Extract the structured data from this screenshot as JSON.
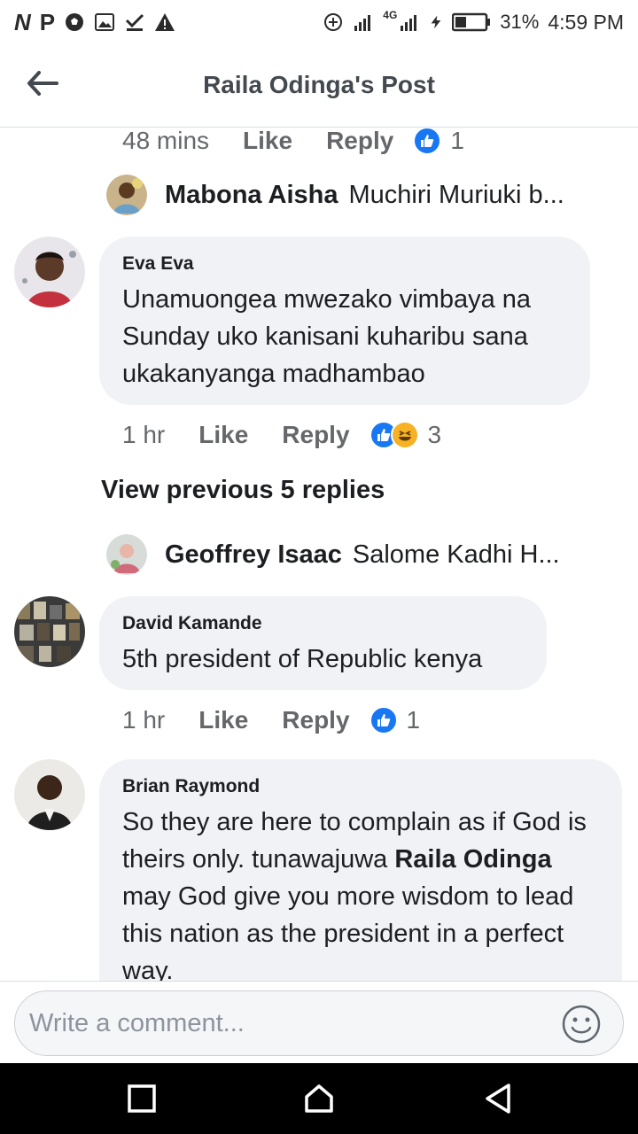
{
  "status_bar": {
    "left_icons": [
      "N",
      "P"
    ],
    "left_icon_names": [
      "soccer-icon",
      "image-icon",
      "check-icon",
      "warning-icon"
    ],
    "battery": "31%",
    "time": "4:59 PM",
    "network": "4G"
  },
  "header": {
    "title": "Raila Odinga's Post"
  },
  "first_meta": {
    "time": "48 mins",
    "like": "Like",
    "reply": "Reply",
    "count": "1"
  },
  "reply_preview_1": {
    "author": "Mabona Aisha",
    "text": "Muchiri Muriuki b..."
  },
  "comments": [
    {
      "author": "Eva Eva",
      "lines": [
        "Unamuongea mwezako vimbaya na",
        "Sunday uko kanisani kuharibu sana",
        "ukakanyanga madhambao"
      ],
      "time": "1 hr",
      "like": "Like",
      "reply": "Reply",
      "count": "3"
    },
    {
      "author": "David Kamande",
      "lines": [
        "5th president of Republic kenya"
      ],
      "time": "1 hr",
      "like": "Like",
      "reply": "Reply",
      "count": "1"
    },
    {
      "author": "Brian Raymond",
      "text_a": "So they are here to complain as if God is theirs only. tunawajuwa ",
      "mention": "Raila Odinga",
      "text_b": " may  God give you more wisdom to lead this nation as the president in a perfect way."
    }
  ],
  "view_previous": "View previous 5 replies",
  "reply_preview_2": {
    "author": "Geoffrey Isaac",
    "text": "Salome Kadhi H..."
  },
  "composer": {
    "placeholder": "Write a comment..."
  },
  "colors": {
    "like_blue": "#1877f2",
    "haha_yellow": "#f7b125",
    "bubble_gray": "#f0f2f5",
    "meta_gray": "#65676b"
  }
}
